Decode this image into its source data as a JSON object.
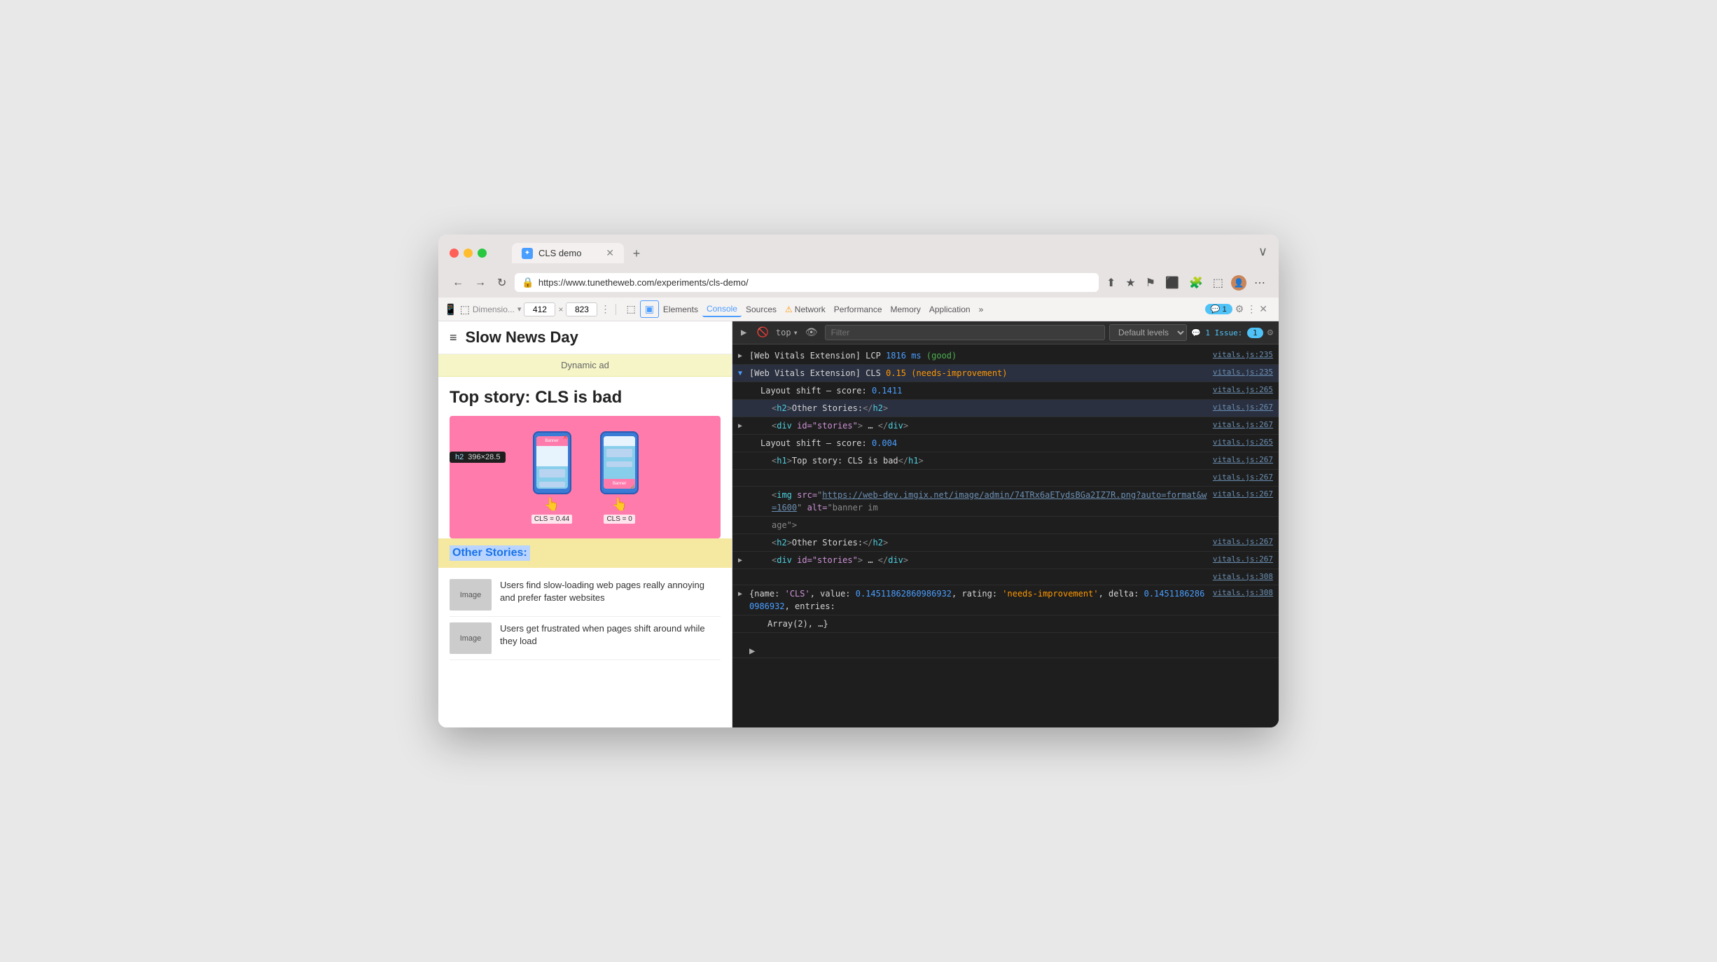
{
  "browser": {
    "tab_title": "CLS demo",
    "tab_favicon": "✦",
    "url": "https://www.tunetheweb.com/experiments/cls-demo/",
    "new_tab_icon": "+",
    "chevron_down": "∨",
    "nav_back": "←",
    "nav_forward": "→",
    "nav_refresh": "↻"
  },
  "devtools_tabs": {
    "responsive_icon": "📱",
    "cursor_icon": "⬚",
    "dimension_width": "412",
    "dimension_height": "823",
    "more_icon": "⋮",
    "elements_label": "Elements",
    "console_label": "Console",
    "sources_label": "Sources",
    "network_label": "Network",
    "performance_label": "Performance",
    "memory_label": "Memory",
    "application_label": "Application",
    "more_tabs_icon": "»",
    "issues_badge": "1",
    "settings_icon": "⚙",
    "menu_icon": "⋮",
    "close_icon": "✕"
  },
  "console_toolbar": {
    "play_icon": "▶",
    "stop_icon": "🚫",
    "top_label": "top",
    "dropdown_icon": "▾",
    "eye_icon": "👁",
    "filter_placeholder": "Filter",
    "default_levels": "Default levels",
    "dropdown_icon2": "▾",
    "issues_label": "1 Issue:",
    "issues_count": "1",
    "settings_icon": "⚙"
  },
  "console_entries": [
    {
      "type": "normal",
      "indent": 0,
      "expandable": false,
      "content": "[Web Vitals Extension] LCP ",
      "value": "1816 ms",
      "value_class": "c-blue",
      "suffix": " (good)",
      "suffix_class": "good-badge",
      "link": "vitals.js:235",
      "background": ""
    },
    {
      "type": "expanded",
      "indent": 0,
      "expandable": true,
      "expanded": true,
      "content": "[Web Vitals Extension] CLS ",
      "value": "0.15",
      "value_class": "c-orange",
      "suffix": " (needs-improvement)",
      "suffix_class": "needs-improvement-badge",
      "link": "vitals.js:235",
      "background": "highlighted"
    },
    {
      "type": "sub",
      "indent": 1,
      "expandable": false,
      "content": "Layout shift – score: ",
      "value": "0.1411",
      "value_class": "c-blue",
      "link": "vitals.js:265",
      "background": ""
    },
    {
      "type": "sub",
      "indent": 2,
      "expandable": false,
      "html": true,
      "tag": "h2",
      "content": "Other Stories:",
      "close": "/h2",
      "link": "vitals.js:267",
      "background": "highlighted"
    },
    {
      "type": "sub",
      "indent": 2,
      "expandable": true,
      "expanded": false,
      "html_div": true,
      "content": "<div id=\"stories\"> … </div>",
      "link": "vitals.js:267",
      "background": ""
    },
    {
      "type": "sub",
      "indent": 1,
      "expandable": false,
      "content": "Layout shift – score: ",
      "value": "0.004",
      "value_class": "c-blue",
      "link": "vitals.js:265",
      "background": ""
    },
    {
      "type": "sub",
      "indent": 2,
      "expandable": false,
      "html": true,
      "tag": "h1",
      "content": "Top story: CLS is bad",
      "close": "/h1",
      "link": "vitals.js:267",
      "background": ""
    },
    {
      "type": "blank",
      "link": "vitals.js:267",
      "background": ""
    },
    {
      "type": "sub",
      "indent": 2,
      "expandable": false,
      "img": true,
      "link": "vitals.js:267",
      "background": ""
    },
    {
      "type": "blank2",
      "link": "vitals.js:267",
      "background": ""
    },
    {
      "type": "sub",
      "indent": 2,
      "expandable": false,
      "h2simple": true,
      "link": "vitals.js:267",
      "background": ""
    },
    {
      "type": "sub",
      "indent": 2,
      "expandable": true,
      "expanded": false,
      "html_div2": true,
      "link": "vitals.js:267",
      "background": ""
    },
    {
      "type": "blank3",
      "link": "vitals.js:308",
      "background": ""
    },
    {
      "type": "object",
      "indent": 0,
      "expandable": true,
      "expanded": false,
      "link": "vitals.js:308",
      "background": ""
    },
    {
      "type": "expand_more",
      "indent": 0,
      "link": "",
      "background": ""
    }
  ],
  "webpage": {
    "hamburger": "≡",
    "site_title": "Slow News Day",
    "ad_text": "Dynamic ad",
    "article_title": "Top story: CLS is bad",
    "cls_left_label": "CLS = 0.44",
    "cls_right_label": "CLS = 0",
    "x_mark": "✕",
    "check_mark": "✓",
    "other_stories_title": "Other Stories:",
    "story1_thumb": "Image",
    "story1_text": "Users find slow-loading web pages really annoying and prefer faster websites",
    "story2_thumb": "Image",
    "story2_text": "Users get frustrated when pages shift around while they load",
    "h2_tag": "h2",
    "h2_size": "396×28.5"
  }
}
